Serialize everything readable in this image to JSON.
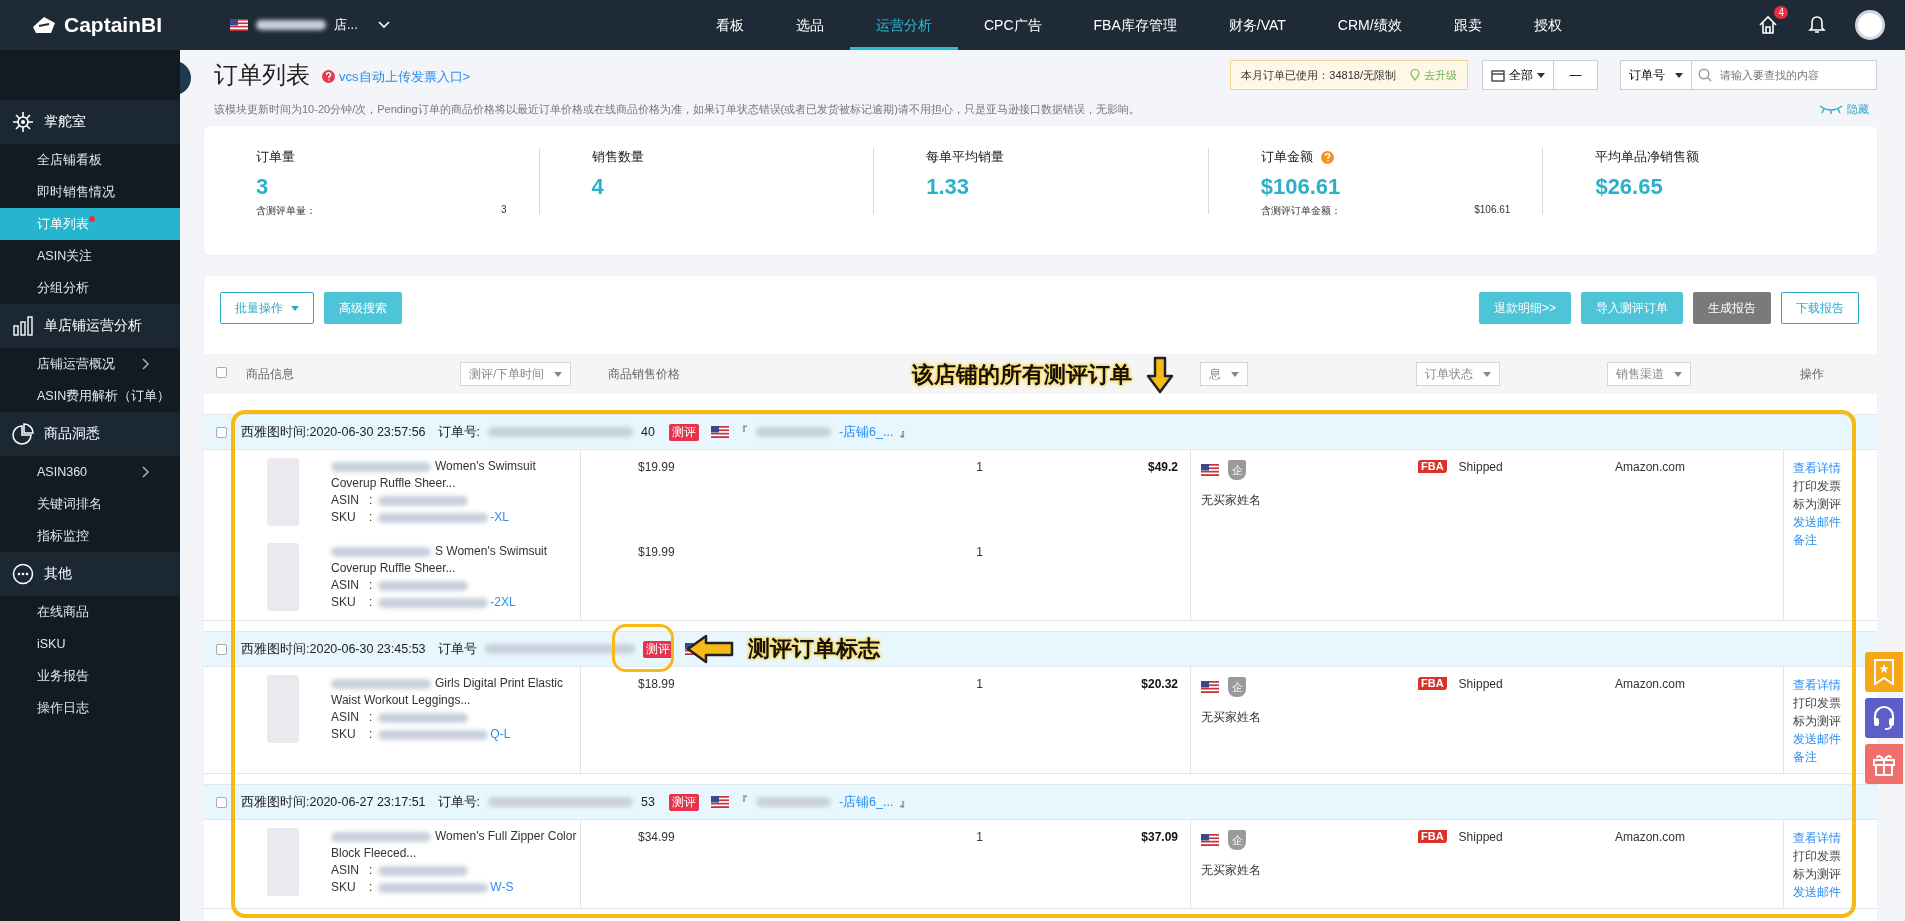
{
  "topbar": {
    "logo": "CaptainBI",
    "store": {
      "tail": "店..."
    },
    "nav": [
      {
        "label": "看板",
        "selected": false
      },
      {
        "label": "选品",
        "selected": false
      },
      {
        "label": "运营分析",
        "selected": true
      },
      {
        "label": "CPC广告",
        "selected": false
      },
      {
        "label": "FBA库存管理",
        "selected": false
      },
      {
        "label": "财务/VAT",
        "selected": false
      },
      {
        "label": "CRM/绩效",
        "selected": false
      },
      {
        "label": "跟卖",
        "selected": false
      },
      {
        "label": "授权",
        "selected": false
      }
    ],
    "notification_count": "4"
  },
  "sidebar": {
    "sections": [
      {
        "label": "掌舵室",
        "kind": "helm",
        "items": [
          {
            "label": "全店铺看板",
            "selected": false,
            "dot": false,
            "submenu": false
          },
          {
            "label": "即时销售情况",
            "selected": false,
            "dot": false,
            "submenu": false
          },
          {
            "label": "订单列表",
            "selected": true,
            "dot": true,
            "submenu": false
          },
          {
            "label": "ASIN关注",
            "selected": false,
            "dot": false,
            "submenu": false
          },
          {
            "label": "分组分析",
            "selected": false,
            "dot": false,
            "submenu": false
          }
        ]
      },
      {
        "label": "单店铺运营分析",
        "kind": "bars",
        "items": [
          {
            "label": "店铺运营概况",
            "selected": false,
            "dot": false,
            "submenu": true
          },
          {
            "label": "ASIN费用解析（订单）",
            "selected": false,
            "dot": false,
            "submenu": false
          }
        ]
      },
      {
        "label": "商品洞悉",
        "kind": "pie",
        "items": [
          {
            "label": "ASIN360",
            "selected": false,
            "dot": false,
            "submenu": true
          },
          {
            "label": "关键词排名",
            "selected": false,
            "dot": false,
            "submenu": false
          },
          {
            "label": "指标监控",
            "selected": false,
            "dot": false,
            "submenu": false
          }
        ]
      },
      {
        "label": "其他",
        "kind": "dots",
        "items": [
          {
            "label": "在线商品",
            "selected": false,
            "dot": false,
            "submenu": false
          },
          {
            "label": "iSKU",
            "selected": false,
            "dot": false,
            "submenu": false
          },
          {
            "label": "业务报告",
            "selected": false,
            "dot": false,
            "submenu": false
          },
          {
            "label": "操作日志",
            "selected": false,
            "dot": false,
            "submenu": false
          }
        ]
      }
    ]
  },
  "page": {
    "title": "订单列表",
    "help_link": "vcs自动上传发票入口>",
    "notice": "该模块更新时间为10-20分钟/次，Pending订单的商品价格将以最近订单价格或在线商品价格为准，如果订单状态错误(或者已发货被标记逾期)请不用担心，只是亚马逊接口数据错误，无影响。",
    "quota": "本月订单已使用：34818/无限制",
    "upgrade": "去升级",
    "range": "全部",
    "range_dash": "—",
    "search_type": "订单号",
    "search_placeholder": "请输入要查找的内容",
    "hide": "隐藏"
  },
  "stats": [
    {
      "label": "订单量",
      "value": "3",
      "help": false,
      "sub_label": "含测评单量：",
      "sub_value": "3"
    },
    {
      "label": "销售数量",
      "value": "4",
      "help": false
    },
    {
      "label": "每单平均销量",
      "value": "1.33",
      "help": false
    },
    {
      "label": "订单金额",
      "value": "$106.61",
      "help": true,
      "sub_label": "含测评订单金额：",
      "sub_value": "$106.61"
    },
    {
      "label": "平均单品净销售额",
      "value": "$26.65",
      "help": false
    }
  ],
  "toolbar": {
    "batch": "批量操作",
    "advanced": "高级搜索",
    "buttons": [
      {
        "label": "退款明细>>",
        "kind": "teal"
      },
      {
        "label": "导入测评订单",
        "kind": "teal"
      },
      {
        "label": "生成报告",
        "kind": "gray"
      },
      {
        "label": "下载报告",
        "kind": "outline"
      }
    ]
  },
  "select_all": {
    "checked": false
  },
  "columns": [
    {
      "label": "商品信息",
      "kind": "text"
    },
    {
      "label": "测评/下单时间",
      "kind": "select"
    },
    {
      "label": "商品销售价格",
      "kind": "text"
    },
    {
      "label": "息",
      "kind": "select"
    },
    {
      "label": "订单状态",
      "kind": "select"
    },
    {
      "label": "销售渠道",
      "kind": "select"
    },
    {
      "label": "操作",
      "kind": "text"
    }
  ],
  "orders": [
    {
      "checked": false,
      "time": "西雅图时间:2020-06-30 23:57:56",
      "order_label": "订单号:",
      "order_tail": "40",
      "tag": "测评",
      "store": {
        "open": "『",
        "tail": "-店铺6_...",
        "close": "』"
      },
      "items": [
        {
          "title": "Women's Swimsuit Coverup Ruffle Sheer...",
          "asin_label": "ASIN",
          "asin_sep": ":",
          "sku_label": "SKU",
          "sku_sep": ":",
          "sku_tail": "-XL",
          "price": "$19.99",
          "qty": "1"
        },
        {
          "title": "S Women's Swimsuit Coverup Ruffle Sheer...",
          "asin_label": "ASIN",
          "asin_sep": ":",
          "sku_label": "SKU",
          "sku_sep": ":",
          "sku_tail": "-2XL",
          "price": "$19.99",
          "qty": "1"
        }
      ],
      "total": "$49.2",
      "badge": "企",
      "buyer": "无买家姓名",
      "fulfillment": "FBA",
      "status": "Shipped",
      "channel": "Amazon.com",
      "actions": [
        {
          "label": "查看详情",
          "kind": "link"
        },
        {
          "label": "打印发票",
          "kind": "text"
        },
        {
          "label": "标为测评",
          "kind": "text"
        },
        {
          "label": "发送邮件",
          "kind": "link"
        },
        {
          "label": "备注",
          "kind": "link"
        }
      ]
    },
    {
      "checked": false,
      "time": "西雅图时间:2020-06-30 23:45:53",
      "order_label": "订单号",
      "tag": "测评",
      "items": [
        {
          "title": "Girls Digital Print Elastic Waist Workout Leggings...",
          "asin_label": "ASIN",
          "asin_sep": ":",
          "sku_label": "SKU",
          "sku_sep": ":",
          "sku_tail": "Q-L",
          "price": "$18.99",
          "qty": "1"
        }
      ],
      "total": "$20.32",
      "badge": "企",
      "buyer": "无买家姓名",
      "fulfillment": "FBA",
      "status": "Shipped",
      "channel": "Amazon.com",
      "actions": [
        {
          "label": "查看详情",
          "kind": "link"
        },
        {
          "label": "打印发票",
          "kind": "text"
        },
        {
          "label": "标为测评",
          "kind": "text"
        },
        {
          "label": "发送邮件",
          "kind": "link"
        },
        {
          "label": "备注",
          "kind": "link"
        }
      ]
    },
    {
      "checked": false,
      "time": "西雅图时间:2020-06-27 23:17:51",
      "order_label": "订单号:",
      "order_tail": "53",
      "tag": "测评",
      "store": {
        "open": "『",
        "tail": "-店铺6_...",
        "close": "』"
      },
      "items": [
        {
          "title": "Women's Full Zipper Color Block Fleeced...",
          "asin_label": "ASIN",
          "asin_sep": ":",
          "sku_label": "SKU",
          "sku_sep": ":",
          "sku_tail": "W-S",
          "price": "$34.99",
          "qty": "1"
        }
      ],
      "total": "$37.09",
      "badge": "企",
      "buyer": "无买家姓名",
      "fulfillment": "FBA",
      "status": "Shipped",
      "channel": "Amazon.com",
      "actions": [
        {
          "label": "查看详情",
          "kind": "link"
        },
        {
          "label": "打印发票",
          "kind": "text"
        },
        {
          "label": "标为测评",
          "kind": "text"
        },
        {
          "label": "发送邮件",
          "kind": "link"
        }
      ]
    }
  ],
  "annotations": {
    "frame_label": "该店铺的所有测评订单",
    "tag_label": "测评订单标志"
  }
}
